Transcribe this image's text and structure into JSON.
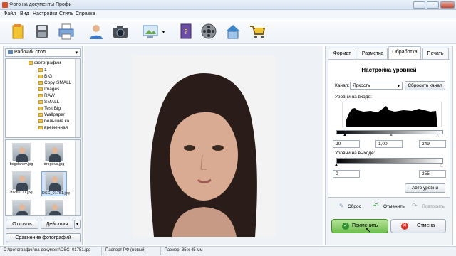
{
  "window": {
    "title": "Фото на документы Профи"
  },
  "menu": [
    "Файл",
    "Вид",
    "Настройки",
    "Стиль",
    "Справка"
  ],
  "toolbar": {
    "icons": [
      "open-icon",
      "save-icon",
      "print-icon",
      "user-icon",
      "camera-icon",
      "scan-icon",
      "book-icon",
      "film-icon",
      "home-icon",
      "cart-icon"
    ]
  },
  "left": {
    "folder": "Рабочий стол",
    "tree": [
      "фотографии",
      "1",
      "BIG",
      "Copy SMALL",
      "Images",
      "RAW",
      "SMALL",
      "Test Big",
      "Wallpaper",
      "большие ко",
      "временная"
    ],
    "thumbnails": [
      "bogdanov.jpg",
      "drogova.jpg",
      "dscf0171.jpg",
      "DSC_01751.jpg",
      "",
      ""
    ],
    "open_label": "Открыть",
    "actions_label": "Действия",
    "compare_label": "Сравнение фотографий"
  },
  "tabs": [
    "Формат",
    "Разметка",
    "Обработка",
    "Печать"
  ],
  "levels": {
    "title": "Настройка уровней",
    "channel_label": "Канал:",
    "channel_value": "Яркость",
    "reset_channel": "Сбросить канал",
    "input_label": "Уровни на входе:",
    "input_black": "20",
    "input_gamma": "1,00",
    "input_white": "249",
    "output_label": "Уровни на выходе:",
    "output_black": "0",
    "output_white": "255",
    "auto_label": "Авто уровни"
  },
  "history": {
    "reset": "Сброс",
    "undo": "Отменить",
    "redo": "Повторить"
  },
  "actions": {
    "apply": "Применить",
    "cancel": "Отмена"
  },
  "status": {
    "path": "D:\\фотографии\\на документ\\DSC_01751.jpg",
    "doc": "Паспорт РФ (новый)",
    "size": "Размер: 35 x 45 мм"
  }
}
